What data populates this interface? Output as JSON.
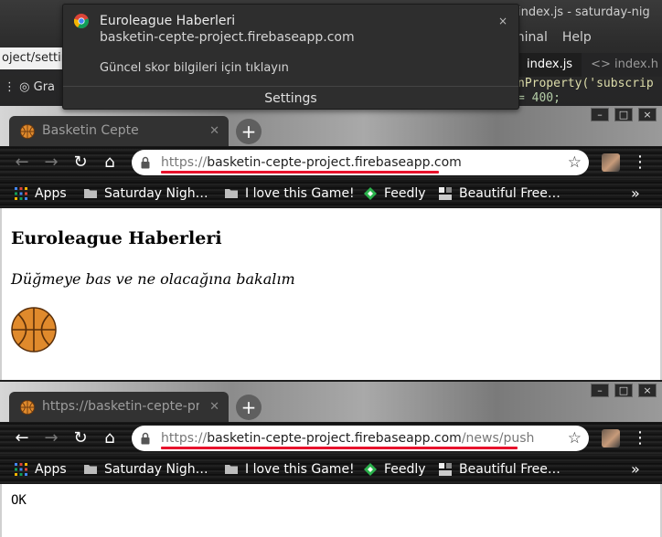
{
  "background": {
    "editor_title": "index.js - saturday-nig",
    "editor_menu": [
      "minal",
      "Help"
    ],
    "url_fragment": "oject/settin",
    "bookmark_fragment": "Gra",
    "editor_tabs": [
      {
        "label": "index.js",
        "active": true
      },
      {
        "label": "<> index.h",
        "active": false
      }
    ],
    "code_line_1": "nProperty('subscrip",
    "code_line_2": "= 400;"
  },
  "notification": {
    "title": "Euroleague Haberleri",
    "site": "basketin-cepte-project.firebaseapp.com",
    "close_label": "×",
    "body": "Güncel skor bilgileri için tıklayın",
    "settings_label": "Settings",
    "icon": "chrome-icon"
  },
  "window1": {
    "tab_title": "Basketin Cepte",
    "url_scheme": "https://",
    "url_host": "basketin-cepte-project.firebaseapp.com",
    "url_path": "",
    "bookmarks": [
      {
        "label": "Apps",
        "icon": "apps-grid-icon"
      },
      {
        "label": "Saturday Nigh…",
        "icon": "folder-icon"
      },
      {
        "label": "I love this Game!",
        "icon": "folder-icon"
      },
      {
        "label": "Feedly",
        "icon": "feedly-icon"
      },
      {
        "label": "Beautiful Free…",
        "icon": "page-icon"
      }
    ],
    "page": {
      "heading": "Euroleague Haberleri",
      "paragraph": "Düğmeye bas ve ne olacağına bakalım"
    }
  },
  "window2": {
    "tab_title": "https://basketin-cepte-pro",
    "url_scheme": "https://",
    "url_host": "basketin-cepte-project.firebaseapp.com",
    "url_path": "/news/push",
    "bookmarks": [
      {
        "label": "Apps",
        "icon": "apps-grid-icon"
      },
      {
        "label": "Saturday Nigh…",
        "icon": "folder-icon"
      },
      {
        "label": "I love this Game!",
        "icon": "folder-icon"
      },
      {
        "label": "Feedly",
        "icon": "feedly-icon"
      },
      {
        "label": "Beautiful Free…",
        "icon": "page-icon"
      }
    ],
    "page": {
      "body_text": "OK"
    }
  },
  "colors": {
    "highlight_underline": "#e8122c",
    "basketball": "#e08a2c"
  }
}
